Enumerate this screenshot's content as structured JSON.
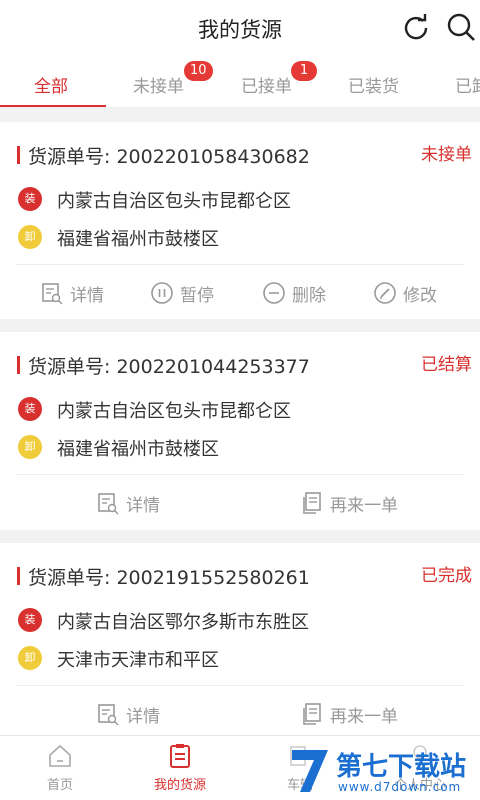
{
  "header": {
    "title": "我的货源",
    "refresh_icon": "refresh-icon",
    "search_icon": "search-icon"
  },
  "tabs": [
    {
      "label": "全部",
      "active": true
    },
    {
      "label": "未接单",
      "badge": "10"
    },
    {
      "label": "已接单",
      "badge": "1"
    },
    {
      "label": "已装货"
    },
    {
      "label": "已卸"
    }
  ],
  "cards": [
    {
      "order": "货源单号: 2002201058430682",
      "status": "未接单",
      "load_tag": "装",
      "load_addr": "内蒙古自治区包头市昆都仑区",
      "unload_tag": "卸",
      "unload_addr": "福建省福州市鼓楼区",
      "actions": [
        "详情",
        "暂停",
        "删除",
        "修改"
      ]
    },
    {
      "order": "货源单号: 2002201044253377",
      "status": "已结算",
      "load_tag": "装",
      "load_addr": "内蒙古自治区包头市昆都仑区",
      "unload_tag": "卸",
      "unload_addr": "福建省福州市鼓楼区",
      "actions": [
        "详情",
        "再来一单"
      ]
    },
    {
      "order": "货源单号: 2002191552580261",
      "status": "已完成",
      "load_tag": "装",
      "load_addr": "内蒙古自治区鄂尔多斯市东胜区",
      "unload_tag": "卸",
      "unload_addr": "天津市天津市和平区",
      "actions": [
        "详情",
        "再来一单"
      ]
    }
  ],
  "bottom_nav": [
    {
      "label": "首页",
      "icon": "home-icon"
    },
    {
      "label": "我的货源",
      "icon": "cargo-list-icon",
      "active": true
    },
    {
      "label": "车辆",
      "icon": "truck-icon"
    },
    {
      "label": "个人中心",
      "icon": "user-icon"
    }
  ],
  "watermark": {
    "name": "第七下载站",
    "url": "www.d7down.com"
  },
  "colors": {
    "accent": "#d8302e",
    "load": "#d8302e",
    "unload": "#f0cc3a",
    "watermark": "#1a6fd1"
  }
}
